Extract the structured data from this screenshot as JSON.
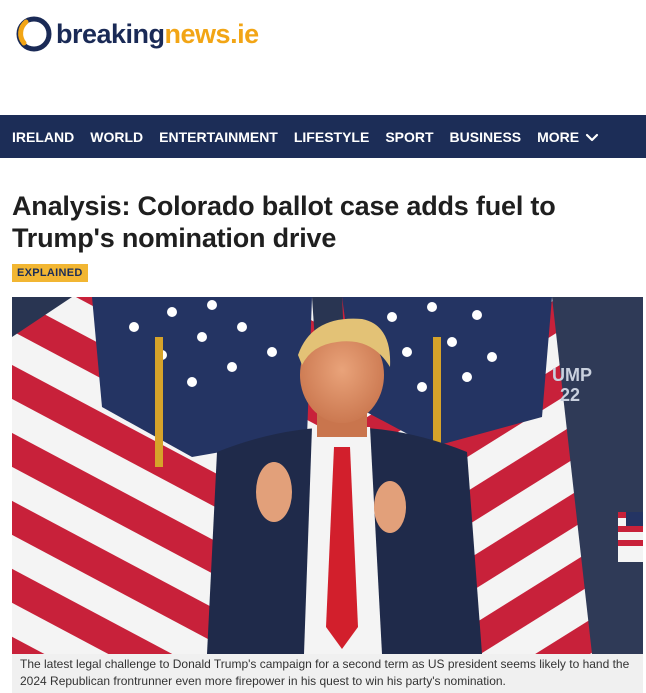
{
  "logo": {
    "part1": "breaking",
    "part2": "news.ie"
  },
  "nav": {
    "items": [
      "IRELAND",
      "WORLD",
      "ENTERTAINMENT",
      "LIFESTYLE",
      "SPORT",
      "BUSINESS",
      "MORE"
    ],
    "more_icon": "chevron-down-icon"
  },
  "article": {
    "headline": "Analysis: Colorado ballot case adds fuel to Trump's nomination drive",
    "badge": "EXPLAINED",
    "image_sign_text": "UMP\n22",
    "caption": "The latest legal challenge to Donald Trump's campaign for a second term as US president seems likely to hand the 2024 Republican frontrunner even more firepower in his quest to win his party's nomination."
  },
  "colors": {
    "nav_bg": "#1c2d57",
    "brand_navy": "#1a2a56",
    "brand_orange": "#f2a515",
    "badge_bg": "#f2b632",
    "caption_bg": "#f0f0f0"
  }
}
